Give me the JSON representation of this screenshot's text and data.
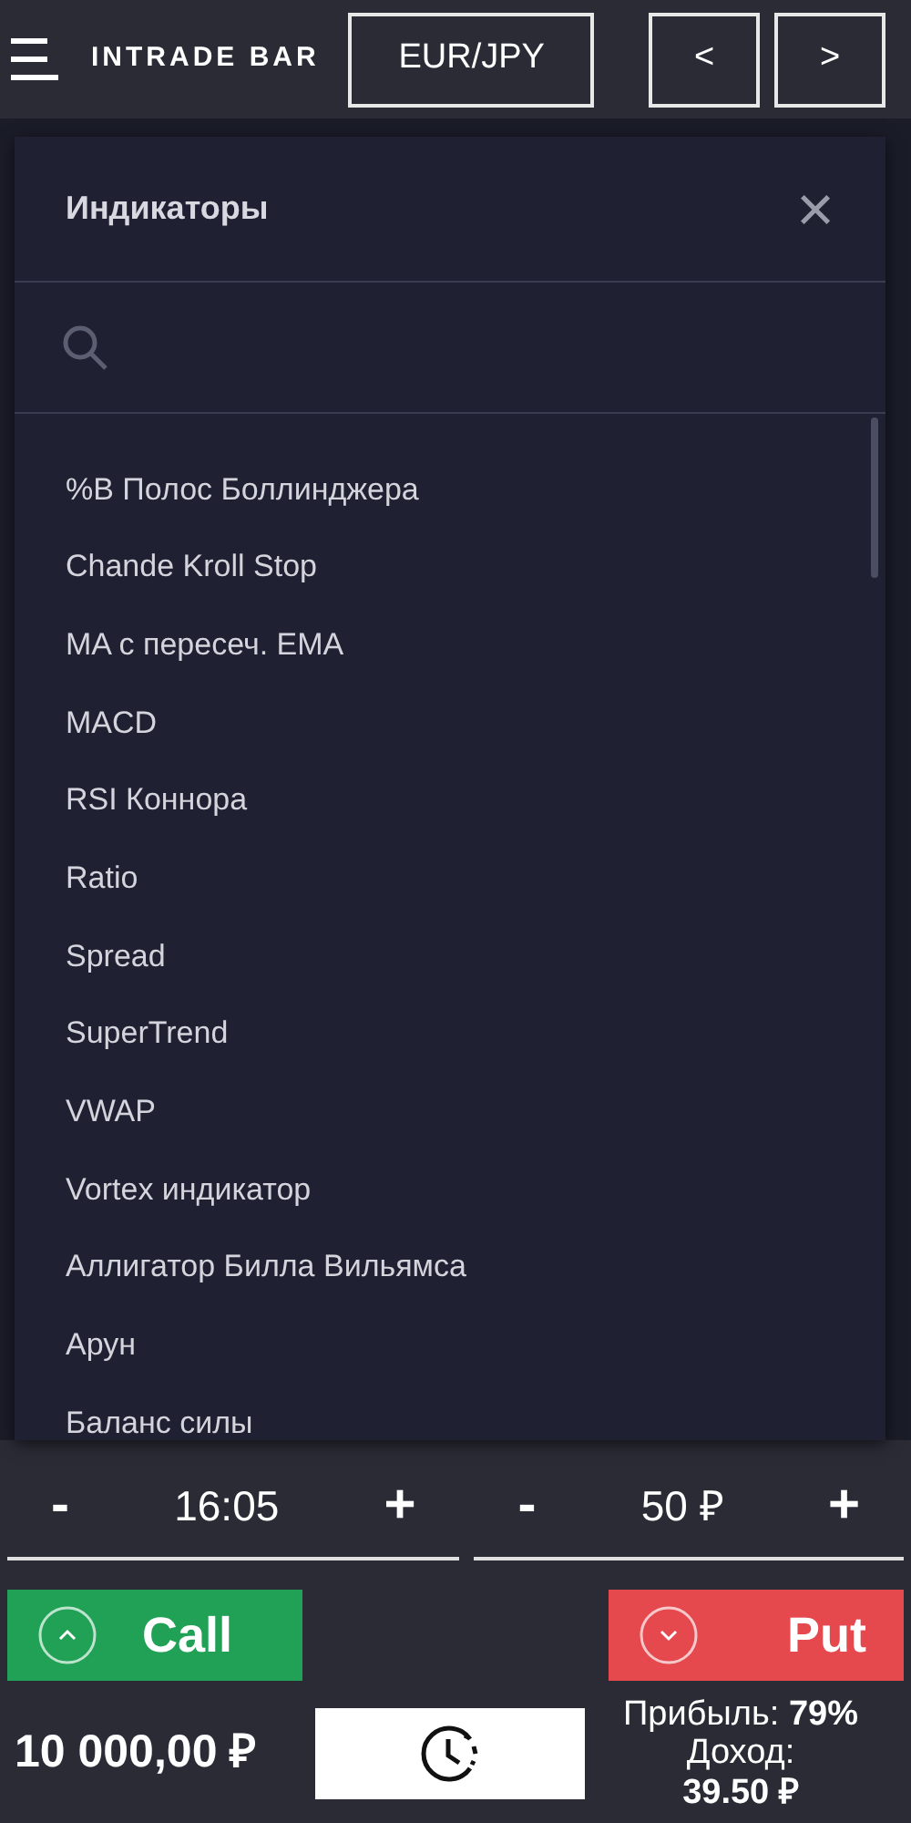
{
  "header": {
    "logo": "INTRADE BAR",
    "pair": "EUR/JPY",
    "prev": "<",
    "next": ">"
  },
  "modal": {
    "title": "Индикаторы",
    "close": "×",
    "items": [
      "%B Полос Боллинджера",
      "Chande Kroll Stop",
      "MA с пересеч. EMA",
      "MACD",
      "RSI Коннора",
      "Ratio",
      "Spread",
      "SuperTrend",
      "VWAP",
      "Vortex индикатор",
      "Аллигатор Билла Вильямса",
      "Арун",
      "Баланс силы"
    ]
  },
  "steppers": [
    {
      "minus": "-",
      "value": "16:05",
      "plus": "+"
    },
    {
      "minus": "-",
      "value": "50 ₽",
      "plus": "+"
    }
  ],
  "call": {
    "label": "Call"
  },
  "put": {
    "label": "Put"
  },
  "balance": "10 000,00 ₽",
  "profit": "Прибыль: **79%**",
  "income_label": "Доход:",
  "income_value": "39.50 ₽"
}
